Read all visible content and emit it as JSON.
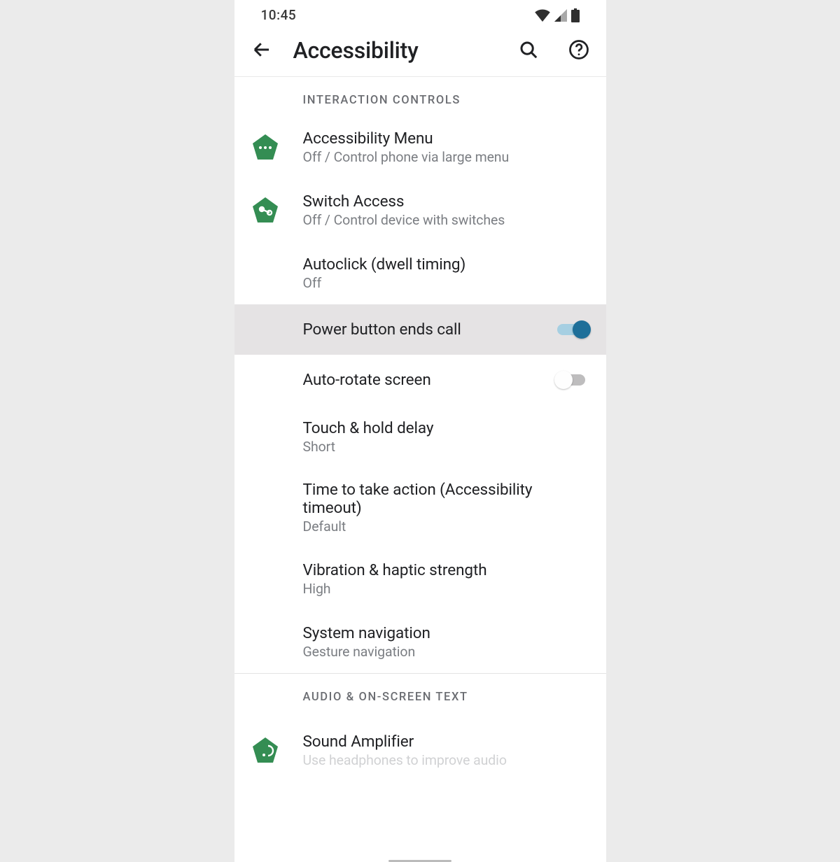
{
  "status": {
    "time": "10:45"
  },
  "header": {
    "title": "Accessibility"
  },
  "sections": {
    "interaction": {
      "header": "Interaction controls",
      "items": {
        "accessibility_menu": {
          "title": "Accessibility Menu",
          "sub": "Off / Control phone via large menu"
        },
        "switch_access": {
          "title": "Switch Access",
          "sub": "Off / Control device with switches"
        },
        "autoclick": {
          "title": "Autoclick (dwell timing)",
          "sub": "Off"
        },
        "power_button": {
          "title": "Power button ends call",
          "toggle": "on"
        },
        "auto_rotate": {
          "title": "Auto-rotate screen",
          "toggle": "off"
        },
        "touch_hold": {
          "title": "Touch & hold delay",
          "sub": "Short"
        },
        "timeout": {
          "title": "Time to take action (Accessibility timeout)",
          "sub": "Default"
        },
        "vibration": {
          "title": "Vibration & haptic strength",
          "sub": "High"
        },
        "system_nav": {
          "title": "System navigation",
          "sub": "Gesture navigation"
        }
      }
    },
    "audio": {
      "header": "Audio & on-screen text",
      "items": {
        "sound_amplifier": {
          "title": "Sound Amplifier",
          "sub": "Use headphones to improve audio"
        }
      }
    }
  }
}
